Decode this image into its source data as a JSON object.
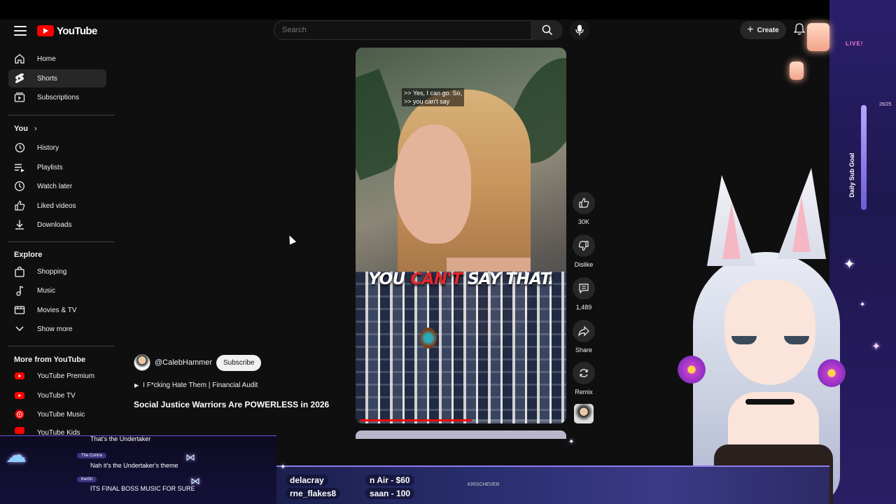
{
  "masthead": {
    "logo_text": "YouTube",
    "search_placeholder": "Search",
    "create_label": "Create"
  },
  "sidebar": {
    "main": [
      {
        "label": "Home",
        "icon": "home-icon"
      },
      {
        "label": "Shorts",
        "icon": "shorts-icon",
        "active": true
      },
      {
        "label": "Subscriptions",
        "icon": "subscriptions-icon"
      }
    ],
    "you_header": "You",
    "you_items": [
      {
        "label": "History",
        "icon": "history-icon"
      },
      {
        "label": "Playlists",
        "icon": "playlists-icon"
      },
      {
        "label": "Watch later",
        "icon": "watch-later-icon"
      },
      {
        "label": "Liked videos",
        "icon": "like-icon"
      },
      {
        "label": "Downloads",
        "icon": "download-icon"
      }
    ],
    "explore_header": "Explore",
    "explore_items": [
      {
        "label": "Shopping",
        "icon": "shopping-icon"
      },
      {
        "label": "Music",
        "icon": "music-icon"
      },
      {
        "label": "Movies & TV",
        "icon": "movies-icon"
      },
      {
        "label": "Show more",
        "icon": "chevron-down-icon"
      }
    ],
    "more_header": "More from YouTube",
    "more_items": [
      {
        "label": "YouTube Premium",
        "icon": "youtube-premium-icon"
      },
      {
        "label": "YouTube TV",
        "icon": "youtube-tv-icon"
      },
      {
        "label": "YouTube Music",
        "icon": "youtube-music-icon"
      },
      {
        "label": "YouTube Kids",
        "icon": "youtube-kids-icon"
      }
    ]
  },
  "video": {
    "caption_top": ">> Yes, I can go. So,\n>> you can't say",
    "caption_big_1": "YOU",
    "caption_big_red": "CAN'T",
    "caption_big_2": "SAY THAT.",
    "progress": 0.55,
    "channel": "@CalebHammer",
    "subscribe_label": "Subscribe",
    "playlist_icon": "play-icon",
    "playlist": "I F*cking Hate Them | Financial Audit",
    "title": "Social Justice Warriors Are POWERLESS in 2026"
  },
  "actions": {
    "like_count": "30K",
    "dislike_label": "Dislike",
    "comment_count": "1,489",
    "share_label": "Share",
    "remix_label": "Remix"
  },
  "overlay": {
    "chat": [
      {
        "text": "That's the Undertaker"
      },
      {
        "user": "The Contra",
        "text": "Nah it's the Undertaker's theme"
      },
      {
        "user": "Ker0n",
        "text": "ITS FINAL BOSS MUSIC FOR SURE"
      }
    ],
    "donations_row1": [
      "delacray",
      "n Air - $60"
    ],
    "donations_row2": [
      "rne_flakes8",
      "saan - 100"
    ],
    "ticker": "KIRSCHEVER",
    "live_label": "LIVE!",
    "subgoal_label": "Daily Sub Goal",
    "subgoal_count": "26/25"
  },
  "colors": {
    "accent_red": "#ff0000",
    "overlay_purple": "#2a2f70"
  }
}
